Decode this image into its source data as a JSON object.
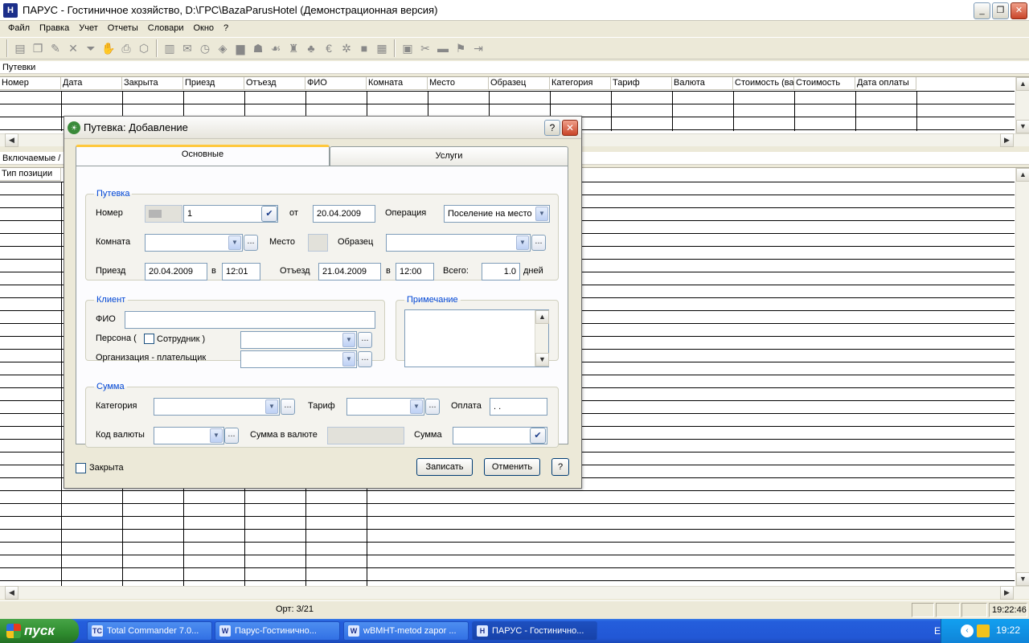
{
  "window": {
    "title": "ПАРУС - Гостиничное хозяйство, D:\\ГРС\\BazaParusHotel (Демонстрационная версия)",
    "app_icon": "parus-icon",
    "controls": [
      "_",
      "❐",
      "✕"
    ]
  },
  "menu": [
    "Файл",
    "Правка",
    "Учет",
    "Отчеты",
    "Словари",
    "Окно",
    "?"
  ],
  "toolbar": {
    "group1": [
      "new-record-icon",
      "copy-record-icon",
      "edit-record-icon",
      "delete-icon",
      "filter-icon",
      "hand-icon",
      "print-icon",
      "package-icon"
    ],
    "group2": [
      "document-icon",
      "envelope-icon",
      "clock-icon",
      "layers-icon",
      "stamp-icon",
      "person-icon",
      "hands-icon",
      "cup-icon",
      "tree-icon",
      "euro-icon",
      "gear-icon",
      "block-icon",
      "chart-icon"
    ],
    "group3": [
      "calculator-icon",
      "tools-icon",
      "folder-icon",
      "run-icon",
      "door-icon"
    ]
  },
  "top_section": {
    "label": "Путевки",
    "columns": [
      "Номер",
      "Дата",
      "Закрыта",
      "Приезд",
      "Отъезд",
      "ФИО",
      "Комната",
      "Место",
      "Образец",
      "Категория",
      "Тариф",
      "Валюта",
      "Стоимость (ва",
      "Стоимость",
      "Дата оплаты"
    ]
  },
  "bottom_section": {
    "label": "Включаемые /",
    "columns": [
      "Тип позиции"
    ]
  },
  "status": {
    "record_count": "Орт: 3/21",
    "clock": "19:22:46"
  },
  "taskbar": {
    "start_label": "пуск",
    "tasks": [
      {
        "label": "Total Commander 7.0...",
        "icon": "TC"
      },
      {
        "label": "Парус-Гостинично...",
        "icon": "W"
      },
      {
        "label": "wBMHT-metod zapor ...",
        "icon": "W"
      },
      {
        "label": "ПАРУС - Гостинично...",
        "icon": "H",
        "active": true
      }
    ],
    "language": "EN",
    "tray_time": "19:22"
  },
  "dialog": {
    "title": "Путевка: Добавление",
    "tabs": [
      {
        "label": "Основные",
        "active": true
      },
      {
        "label": "Услуги",
        "active": false
      }
    ],
    "putevka": {
      "legend": "Путевка",
      "nomer_label": "Номер",
      "nomer_value": "1",
      "ot_label": "от",
      "ot_value": "20.04.2009",
      "operation_label": "Операция",
      "operation_value": "Поселение на место",
      "komnata_label": "Комната",
      "komnata_value": "",
      "mesto_label": "Место",
      "obrazec_label": "Образец",
      "obrazec_value": "",
      "priezd_label": "Приезд",
      "priezd_date": "20.04.2009",
      "priezd_v": "в",
      "priezd_time": "12:01",
      "otezd_label": "Отъезд",
      "otezd_date": "21.04.2009",
      "otezd_v": "в",
      "otezd_time": "12:00",
      "vsego_label": "Всего:",
      "vsego_value": "1.0",
      "days_label": "дней"
    },
    "client": {
      "legend": "Клиент",
      "fio_label": "ФИО",
      "fio_value": "",
      "persona_label": "Персона (",
      "sotrudnik_label": "Сотрудник )",
      "org_label": "Организация - плательщик"
    },
    "note": {
      "legend": "Примечание"
    },
    "summa": {
      "legend": "Сумма",
      "category_label": "Категория",
      "tarif_label": "Тариф",
      "oplata_label": "Оплата",
      "oplata_value": " .  .",
      "currency_label": "Код валюты",
      "sum_currency_label": "Сумма в валюте",
      "sum_label": "Сумма"
    },
    "closed_label": "Закрыта",
    "save_label": "Записать",
    "cancel_label": "Отменить",
    "help_label": "?"
  }
}
